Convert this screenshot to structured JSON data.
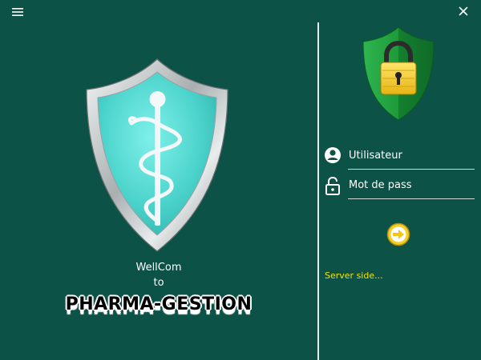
{
  "window": {
    "menu_icon": "hamburger-icon",
    "close_icon": "close-icon"
  },
  "welcome": {
    "line1": "WellCom",
    "line2": "to",
    "brand": "PHARMA-GESTION"
  },
  "login": {
    "username_label": "Utilisateur",
    "password_label": "Mot de pass",
    "submit_icon": "arrow-right-circle-icon",
    "status_text": "Server side..."
  },
  "colors": {
    "background": "#0d5247",
    "shield_teal": "#4fd8d0",
    "shield_green": "#1f9e3c",
    "lock_gold": "#f2d027",
    "status_yellow": "#f5e400"
  }
}
